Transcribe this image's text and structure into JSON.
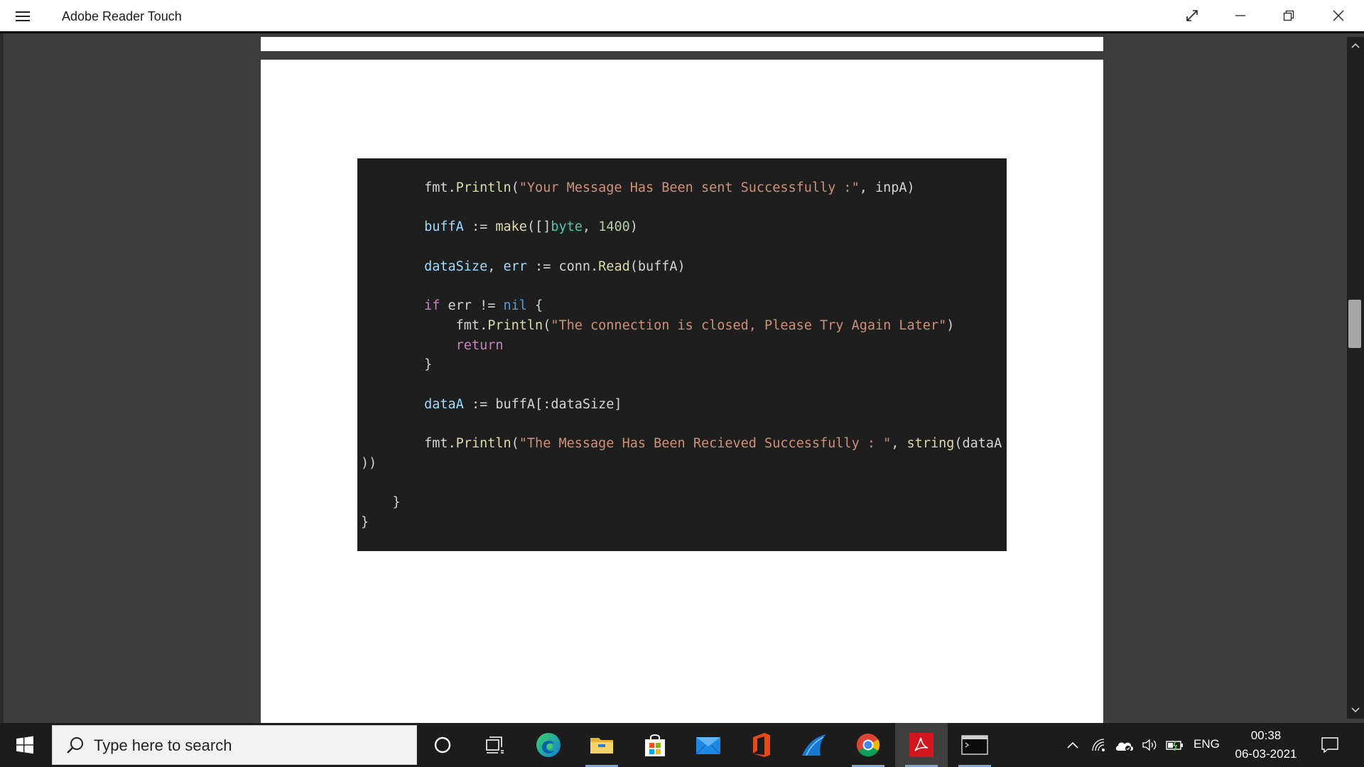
{
  "window": {
    "title": "Adobe Reader Touch"
  },
  "document": {
    "code_lines": [
      [
        {
          "t": "        ",
          "c": "txt"
        },
        {
          "t": "fmt.",
          "c": "txt"
        },
        {
          "t": "Println",
          "c": "fn"
        },
        {
          "t": "(",
          "c": "txt"
        },
        {
          "t": "\"Your Message Has Been sent Successfully :\"",
          "c": "str"
        },
        {
          "t": ", inpA)",
          "c": "txt"
        }
      ],
      [],
      [
        {
          "t": "        ",
          "c": "txt"
        },
        {
          "t": "buffA",
          "c": "var"
        },
        {
          "t": " := ",
          "c": "txt"
        },
        {
          "t": "make",
          "c": "fn"
        },
        {
          "t": "([]",
          "c": "txt"
        },
        {
          "t": "byte",
          "c": "type"
        },
        {
          "t": ", ",
          "c": "txt"
        },
        {
          "t": "1400",
          "c": "num"
        },
        {
          "t": ")",
          "c": "txt"
        }
      ],
      [],
      [
        {
          "t": "        ",
          "c": "txt"
        },
        {
          "t": "dataSize",
          "c": "var"
        },
        {
          "t": ", ",
          "c": "txt"
        },
        {
          "t": "err",
          "c": "var"
        },
        {
          "t": " := conn.",
          "c": "txt"
        },
        {
          "t": "Read",
          "c": "fn"
        },
        {
          "t": "(buffA)",
          "c": "txt"
        }
      ],
      [],
      [
        {
          "t": "        ",
          "c": "txt"
        },
        {
          "t": "if",
          "c": "kw"
        },
        {
          "t": " err != ",
          "c": "txt"
        },
        {
          "t": "nil",
          "c": "nil"
        },
        {
          "t": " {",
          "c": "txt"
        }
      ],
      [
        {
          "t": "            ",
          "c": "txt"
        },
        {
          "t": "fmt.",
          "c": "txt"
        },
        {
          "t": "Println",
          "c": "fn"
        },
        {
          "t": "(",
          "c": "txt"
        },
        {
          "t": "\"The connection is closed, Please Try Again Later\"",
          "c": "str"
        },
        {
          "t": ")",
          "c": "txt"
        }
      ],
      [
        {
          "t": "            ",
          "c": "txt"
        },
        {
          "t": "return",
          "c": "kw"
        }
      ],
      [
        {
          "t": "        }",
          "c": "txt"
        }
      ],
      [],
      [
        {
          "t": "        ",
          "c": "txt"
        },
        {
          "t": "dataA",
          "c": "var"
        },
        {
          "t": " := buffA[:dataSize]",
          "c": "txt"
        }
      ],
      [],
      [
        {
          "t": "        ",
          "c": "txt"
        },
        {
          "t": "fmt.",
          "c": "txt"
        },
        {
          "t": "Println",
          "c": "fn"
        },
        {
          "t": "(",
          "c": "txt"
        },
        {
          "t": "\"The Message Has Been Recieved Successfully : \"",
          "c": "str"
        },
        {
          "t": ", ",
          "c": "txt"
        },
        {
          "t": "string",
          "c": "fn"
        },
        {
          "t": "(dataA",
          "c": "txt"
        }
      ],
      [
        {
          "t": "))",
          "c": "txt"
        }
      ],
      [],
      [
        {
          "t": "    }",
          "c": "txt"
        }
      ],
      [
        {
          "t": "}",
          "c": "txt"
        }
      ]
    ]
  },
  "taskbar": {
    "search_placeholder": "Type here to search",
    "language": "ENG",
    "time": "00:38",
    "date": "06-03-2021"
  },
  "icons": {
    "menu": "hamburger-icon",
    "fullscreen": "expand-icon",
    "minimize": "minimize-icon",
    "restore": "restore-icon",
    "close": "close-icon",
    "start": "windows-start-icon",
    "search": "search-icon",
    "cortana": "cortana-icon",
    "task_view": "task-view-icon",
    "edge": "edge-icon",
    "file_explorer": "file-explorer-icon",
    "store": "store-icon",
    "mail": "mail-icon",
    "office": "office-icon",
    "wireshark": "wireshark-icon",
    "chrome": "chrome-icon",
    "acrobat": "acrobat-icon",
    "terminal": "terminal-icon",
    "notifications": "notifications-icon"
  },
  "colors": {
    "code_background": "#1e1e1e",
    "string": "#ce9178",
    "function": "#dcdcaa",
    "variable": "#9cdcfe",
    "keyword": "#c586c0"
  }
}
